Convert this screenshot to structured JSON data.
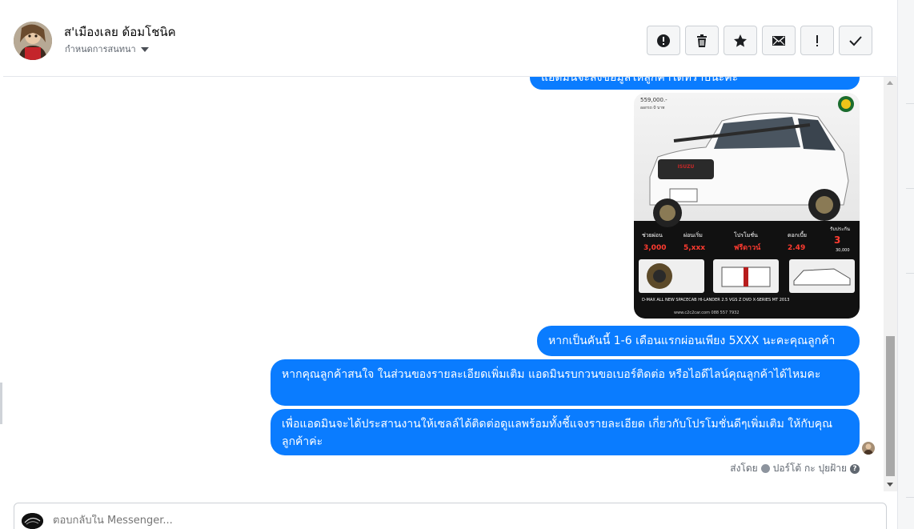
{
  "header": {
    "contact_name": "ส'เมืองเลย ด้อมโชนิค",
    "assign_label": "กำหนดการสนทนา",
    "actions": [
      {
        "icon": "exclamation-circle-icon"
      },
      {
        "icon": "trash-icon"
      },
      {
        "icon": "star-icon"
      },
      {
        "icon": "envelope-icon"
      },
      {
        "icon": "exclamation-icon"
      },
      {
        "icon": "check-icon"
      }
    ]
  },
  "messages": [
    {
      "text": "แอดมินจะส่งข้อมูลให้ลูกค้าได้ทราบนะคะ"
    },
    {
      "text": "หากเป็นคันนี้ 1-6 เดือนแรกผ่อนเพียง 5XXX นะคะคุณลูกค้า"
    },
    {
      "text": "หากคุณลูกค้าสนใจ ในส่วนของรายละเอียดเพิ่มเติม แอดมินรบกวนขอเบอร์ติดต่อ หรือไอดีไลน์คุณลูกค้าได้ไหมคะ"
    },
    {
      "text": "เพื่อแอดมินจะได้ประสานงานให้เซลล์ได้ติดต่อดูแลพร้อมทั้งชี้แจงรายละเอียด เกี่ยวกับโปรโมชั่นดีๆเพิ่มเติม ให้กับคุณลูกค้าค่ะ"
    }
  ],
  "car_ad": {
    "price": "559,000.-",
    "down_note": "ออกรถ 0 บาท",
    "labels": {
      "help_pay": "ช่วยผ่อน",
      "help_pay_value": "3,000",
      "installment": "ผ่อนเริ่ม",
      "installment_value": "5,xxx",
      "promo": "โปรโมชั่น",
      "promo_value": "ฟรีดาวน์",
      "interest": "ดอกเบี้ย",
      "interest_value": "2.49",
      "warranty": "รับประกัน",
      "warranty_value": "3",
      "warranty_km": "30,000"
    },
    "model": "D-MAX ALL NEW SPACECAB HI-LANDER 2.5 VGS Z DVD X-SERIES MT 2013",
    "site": "www.c2c2car.com 088 557 7932",
    "brand": "ISUZU"
  },
  "sent_by": {
    "prefix": "ส่งโดย",
    "name": "ปอร์โต้ กะ ปุยฝ้าย",
    "help": "?"
  },
  "composer": {
    "placeholder": "ตอบกลับใน Messenger..."
  },
  "colors": {
    "bubble": "#0a7cff",
    "text": "#050505",
    "muted": "#606770"
  }
}
